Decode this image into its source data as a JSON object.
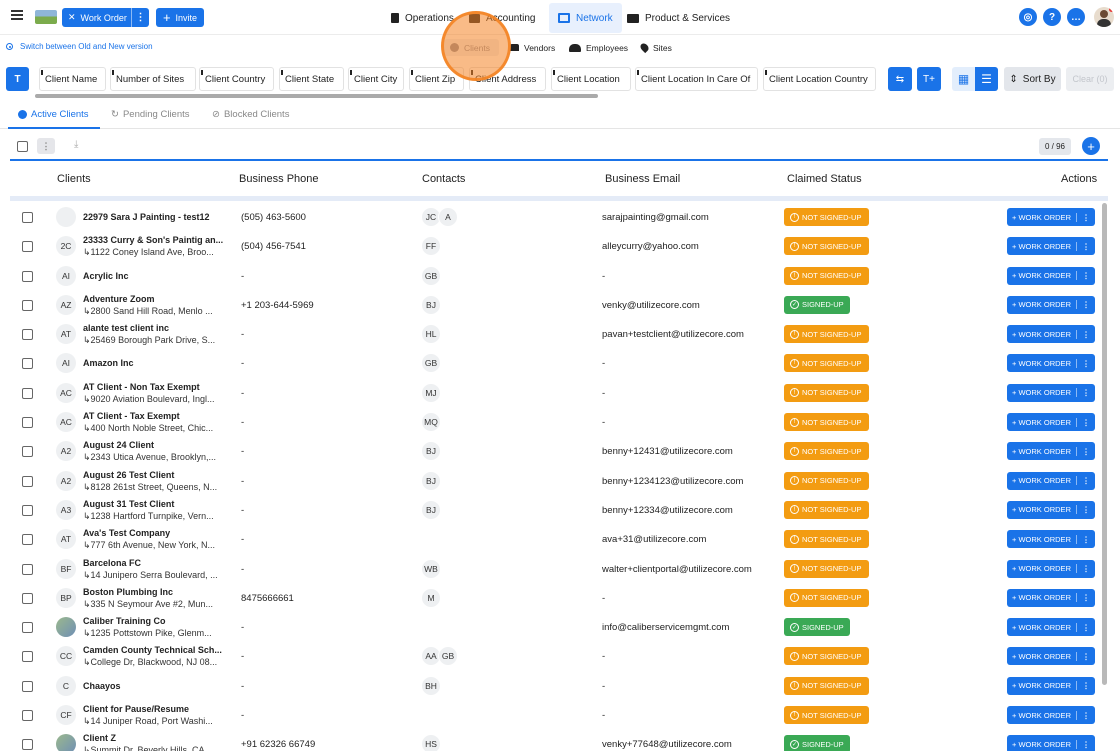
{
  "topbar": {
    "work_order_label": "Work Order",
    "invite_label": "Invite",
    "nav": [
      {
        "label": "Operations"
      },
      {
        "label": "Accounting"
      },
      {
        "label": "Network"
      },
      {
        "label": "Product & Services"
      }
    ]
  },
  "subbar": {
    "switch_label": "Switch between Old and New version",
    "tabs": [
      {
        "label": "Clients"
      },
      {
        "label": "Vendors"
      },
      {
        "label": "Employees"
      },
      {
        "label": "Sites"
      }
    ]
  },
  "columns": [
    "Client Name",
    "Number of Sites",
    "Client Country",
    "Client State",
    "Client City",
    "Client Zip",
    "Client Address",
    "Client Location",
    "Client Location In Care Of",
    "Client Location Country"
  ],
  "toolbar": {
    "sort_label": "Sort By",
    "clear_label": "Clear (0)"
  },
  "status_tabs": [
    {
      "label": "Active Clients"
    },
    {
      "label": "Pending Clients"
    },
    {
      "label": "Blocked Clients"
    }
  ],
  "pagination": {
    "count": "0 / 96"
  },
  "table": {
    "headers": {
      "clients": "Clients",
      "phone": "Business Phone",
      "contacts": "Contacts",
      "email": "Business Email",
      "status": "Claimed Status",
      "actions": "Actions"
    },
    "action_label": "+ WORK ORDER",
    "status_labels": {
      "ns": "NOT SIGNED-UP",
      "s": "SIGNED-UP"
    },
    "rows": [
      {
        "avatar": "",
        "name": "22979 Sara J Painting - test12",
        "address": "",
        "phone": "(505) 463-5600",
        "contacts": [
          "JC",
          "A"
        ],
        "email": "sarajpainting@gmail.com",
        "status": "ns"
      },
      {
        "avatar": "2C",
        "name": "23333 Curry & Son's Paintig an...",
        "address": "↳1122 Coney Island Ave, Broo...",
        "phone": "(504) 456-7541",
        "contacts": [
          "FF"
        ],
        "email": "alleycurry@yahoo.com",
        "status": "ns"
      },
      {
        "avatar": "AI",
        "name": "Acrylic Inc",
        "address": "",
        "phone": "-",
        "contacts": [
          "GB"
        ],
        "email": "-",
        "status": "ns"
      },
      {
        "avatar": "AZ",
        "name": "Adventure Zoom",
        "address": "↳2800 Sand Hill Road, Menlo ...",
        "phone": "+1 203-644-5969",
        "contacts": [
          "BJ"
        ],
        "email": "venky@utilizecore.com",
        "status": "s"
      },
      {
        "avatar": "AT",
        "name": "alante test client inc",
        "address": "↳25469 Borough Park Drive, S...",
        "phone": "-",
        "contacts": [
          "HL"
        ],
        "email": "pavan+testclient@utilizecore.com",
        "status": "ns"
      },
      {
        "avatar": "AI",
        "name": "Amazon Inc",
        "address": "",
        "phone": "-",
        "contacts": [
          "GB"
        ],
        "email": "-",
        "status": "ns"
      },
      {
        "avatar": "AC",
        "name": "AT Client - Non Tax Exempt",
        "address": "↳9020 Aviation Boulevard, Ingl...",
        "phone": "-",
        "contacts": [
          "MJ"
        ],
        "email": "-",
        "status": "ns"
      },
      {
        "avatar": "AC",
        "name": "AT Client - Tax Exempt",
        "address": "↳400 North Noble Street, Chic...",
        "phone": "-",
        "contacts": [
          "MQ"
        ],
        "email": "-",
        "status": "ns"
      },
      {
        "avatar": "A2",
        "name": "August 24 Client",
        "address": "↳2343 Utica Avenue, Brooklyn,...",
        "phone": "-",
        "contacts": [
          "BJ"
        ],
        "email": "benny+12431@utilizecore.com",
        "status": "ns"
      },
      {
        "avatar": "A2",
        "name": "August 26 Test Client",
        "address": "↳8128 261st Street, Queens, N...",
        "phone": "-",
        "contacts": [
          "BJ"
        ],
        "email": "benny+1234123@utilizecore.com",
        "status": "ns"
      },
      {
        "avatar": "A3",
        "name": "August 31 Test Client",
        "address": "↳1238 Hartford Turnpike, Vern...",
        "phone": "-",
        "contacts": [
          "BJ"
        ],
        "email": "benny+12334@utilizecore.com",
        "status": "ns"
      },
      {
        "avatar": "AT",
        "name": "Ava's Test Company",
        "address": "↳777 6th Avenue, New York, N...",
        "phone": "-",
        "contacts": [],
        "email": "ava+31@utilizecore.com",
        "status": "ns"
      },
      {
        "avatar": "BF",
        "name": "Barcelona FC",
        "address": "↳14 Junipero Serra Boulevard, ...",
        "phone": "-",
        "contacts": [
          "WB"
        ],
        "email": "walter+clientportal@utilizecore.com",
        "status": "ns"
      },
      {
        "avatar": "BP",
        "name": "Boston Plumbing Inc",
        "address": "↳335 N Seymour Ave #2, Mun...",
        "phone": "8475666661",
        "contacts": [
          "M"
        ],
        "email": "-",
        "status": "ns"
      },
      {
        "avatar": "",
        "name": "Caliber Training Co",
        "address": "↳1235 Pottstown Pike, Glenm...",
        "phone": "-",
        "contacts": [],
        "email": "info@caliberservicemgmt.com",
        "status": "s"
      },
      {
        "avatar": "CC",
        "name": "Camden County Technical Sch...",
        "address": "↳College Dr, Blackwood, NJ 08...",
        "phone": "-",
        "contacts": [
          "AA",
          "GB"
        ],
        "email": "-",
        "status": "ns"
      },
      {
        "avatar": "C",
        "name": "Chaayos",
        "address": "",
        "phone": "-",
        "contacts": [
          "BH"
        ],
        "email": "-",
        "status": "ns"
      },
      {
        "avatar": "CF",
        "name": "Client for Pause/Resume",
        "address": "↳14 Juniper Road, Port Washi...",
        "phone": "-",
        "contacts": [],
        "email": "-",
        "status": "ns"
      },
      {
        "avatar": "",
        "name": "Client Z",
        "address": "↳Summit Dr, Beverly Hills, CA ...",
        "phone": "+91 62326 66749",
        "contacts": [
          "HS"
        ],
        "email": "venky+77648@utilizecore.com",
        "status": "s"
      }
    ]
  }
}
